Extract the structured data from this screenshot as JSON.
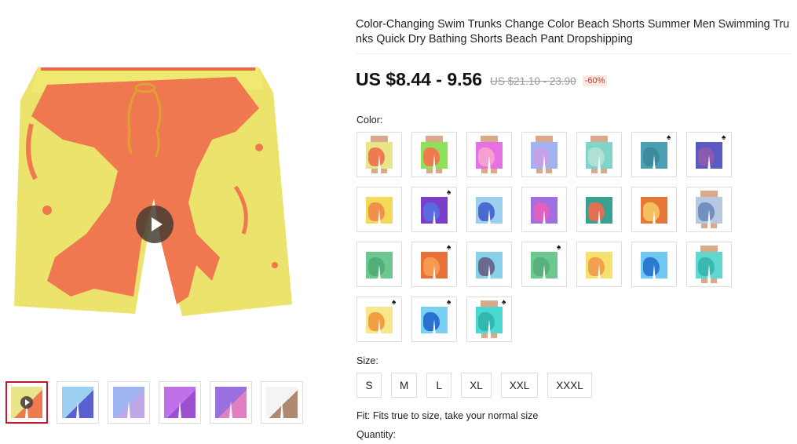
{
  "product": {
    "title": "Color-Changing Swim Trunks Change Color Beach Shorts Summer Men Swimming Trunks Quick Dry Bathing Shorts Beach Pant Dropshipping",
    "price": "US $8.44 - 9.56",
    "original_price": "US $21.10 - 23.90",
    "discount": "-60%"
  },
  "color": {
    "label": "Color:",
    "swatches": [
      {
        "base": "#e9e58a",
        "splash": "#f07a50",
        "model": true,
        "dropship": false
      },
      {
        "base": "#8fe05a",
        "splash": "#f07a50",
        "model": true,
        "dropship": false
      },
      {
        "base": "#e472e0",
        "splash": "#f5a0d0",
        "model": true,
        "dropship": false
      },
      {
        "base": "#9fb4f0",
        "splash": "#c8a0e8",
        "model": true,
        "dropship": false
      },
      {
        "base": "#7fd6c8",
        "splash": "#b0e0d6",
        "model": true,
        "dropship": false
      },
      {
        "base": "#4c9fb0",
        "splash": "#3a8ba0",
        "model": false,
        "dropship": true
      },
      {
        "base": "#5a5ac0",
        "splash": "#8a5ab0",
        "model": false,
        "dropship": true
      },
      {
        "base": "#f5d95a",
        "splash": "#f0904a",
        "model": false,
        "dropship": false
      },
      {
        "base": "#7a3ec8",
        "splash": "#5a6ae0",
        "model": false,
        "dropship": true
      },
      {
        "base": "#9dd0f0",
        "splash": "#4a6ad0",
        "model": false,
        "dropship": false
      },
      {
        "base": "#a070e0",
        "splash": "#e060c0",
        "model": false,
        "dropship": false
      },
      {
        "base": "#3aa090",
        "splash": "#e07050",
        "model": false,
        "dropship": false
      },
      {
        "base": "#e8783a",
        "splash": "#f5c060",
        "model": false,
        "dropship": false
      },
      {
        "base": "#b8c8e0",
        "splash": "#7090c0",
        "model": true,
        "dropship": false
      },
      {
        "base": "#6cc890",
        "splash": "#50b078",
        "model": false,
        "dropship": false
      },
      {
        "base": "#e8703a",
        "splash": "#f59a50",
        "model": false,
        "dropship": true
      },
      {
        "base": "#8ad0e8",
        "splash": "#6a6a90",
        "model": false,
        "dropship": false
      },
      {
        "base": "#6cc890",
        "splash": "#58b07c",
        "model": false,
        "dropship": true
      },
      {
        "base": "#f5e070",
        "splash": "#f0a050",
        "model": false,
        "dropship": false
      },
      {
        "base": "#70c8f0",
        "splash": "#2a7ad0",
        "model": false,
        "dropship": false
      },
      {
        "base": "#60d8d0",
        "splash": "#3ab8b0",
        "model": true,
        "dropship": false
      },
      {
        "base": "#f8e68a",
        "splash": "#f0a040",
        "model": false,
        "dropship": true
      },
      {
        "base": "#7ad0f0",
        "splash": "#2a70d0",
        "model": false,
        "dropship": true
      },
      {
        "base": "#4ad8d0",
        "splash": "#30b8b0",
        "model": true,
        "dropship": true
      }
    ]
  },
  "size": {
    "label": "Size:",
    "options": [
      "S",
      "M",
      "L",
      "XL",
      "XXL",
      "XXXL"
    ]
  },
  "fit_note": "Fit: Fits true to size, take your normal size",
  "quantity_label": "Quantity:",
  "gallery": {
    "thumbnails": [
      {
        "colors": [
          "#e9e58a",
          "#f07a50"
        ],
        "video": true
      },
      {
        "colors": [
          "#9dd0f0",
          "#5a60d0"
        ],
        "video": false
      },
      {
        "colors": [
          "#9fb4f0",
          "#c0a8e8"
        ],
        "video": false
      },
      {
        "colors": [
          "#c070e8",
          "#9a50d0"
        ],
        "video": false
      },
      {
        "colors": [
          "#9a70e0",
          "#e080c0"
        ],
        "video": false
      },
      {
        "colors": [
          "#f4f4f4",
          "#b08a70"
        ],
        "video": false
      }
    ]
  }
}
